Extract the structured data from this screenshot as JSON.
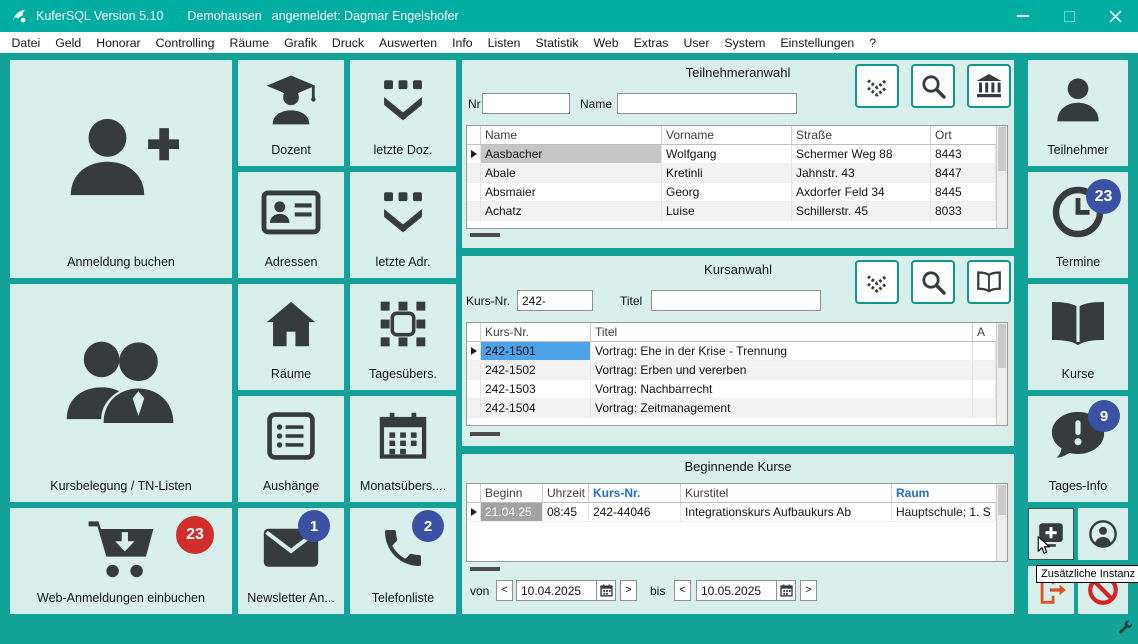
{
  "titlebar": {
    "app": "KuferSQL Version 5.10",
    "location": "Demohausen",
    "login": "angemeldet: Dagmar Engelshofer"
  },
  "menu": [
    "Datei",
    "Geld",
    "Honorar",
    "Controlling",
    "Räume",
    "Grafik",
    "Druck",
    "Auswerten",
    "Info",
    "Listen",
    "Statistik",
    "Web",
    "Extras",
    "User",
    "System",
    "Einstellungen",
    "?"
  ],
  "tiles": {
    "anmeldung_buchen": "Anmeldung buchen",
    "kursbelegung": "Kursbelegung / TN-Listen",
    "web_anmeldungen": "Web-Anmeldungen einbuchen",
    "web_anmeldungen_badge": "23",
    "dozent": "Dozent",
    "adressen": "Adressen",
    "raeume": "Räume",
    "aushaenge": "Aushänge",
    "newsletter": "Newsletter An...",
    "newsletter_badge": "1",
    "letzte_doz": "letzte Doz.",
    "letzte_adr": "letzte Adr.",
    "tagesuebers": "Tagesübers.",
    "monatsuebers": "Monatsübers....",
    "telefonliste": "Telefonliste",
    "telefonliste_badge": "2",
    "teilnehmer": "Teilnehmer",
    "termine": "Termine",
    "termine_badge": "23",
    "kurse": "Kurse",
    "tages_info": "Tages-Info",
    "tages_info_badge": "9"
  },
  "teilnehmeranwahl": {
    "title": "Teilnehmeranwahl",
    "nr_label": "Nr",
    "name_label": "Name",
    "headers": [
      "Name",
      "Vorname",
      "Straße",
      "Ort"
    ],
    "rows": [
      [
        "Aasbacher",
        "Wolfgang",
        "Schermer Weg 88",
        "8443"
      ],
      [
        "Abale",
        "Kretinli",
        "Jahnstr. 43",
        "8447"
      ],
      [
        "Absmaier",
        "Georg",
        "Axdorfer Feld 34",
        "8445"
      ],
      [
        "Achatz",
        "Luise",
        "Schillerstr. 45",
        "8033"
      ]
    ]
  },
  "kursanwahl": {
    "title": "Kursanwahl",
    "kursnr_label": "Kurs-Nr.",
    "kursnr_value": "242-",
    "titel_label": "Titel",
    "headers": [
      "Kurs-Nr.",
      "Titel",
      "A"
    ],
    "rows": [
      [
        "242-1501",
        "Vortrag: Ehe in der Krise - Trennung"
      ],
      [
        "242-1502",
        "Vortrag: Erben und vererben"
      ],
      [
        "242-1503",
        "Vortrag: Nachbarrecht"
      ],
      [
        "242-1504",
        "Vortrag: Zeitmanagement"
      ]
    ]
  },
  "beginnende_kurse": {
    "title": "Beginnende Kurse",
    "headers": [
      "Beginn",
      "Uhrzeit",
      "Kurs-Nr.",
      "Kurstitel",
      "Raum"
    ],
    "rows": [
      [
        "21.04.25",
        "08:45",
        "242-44046",
        "Integrationskurs Aufbaukurs Ab",
        "Hauptschule; 1. S"
      ]
    ],
    "von_label": "von",
    "bis_label": "bis",
    "von_value": "10.04.2025",
    "bis_value": "10.05.2025",
    "prev": "<",
    "next": ">"
  },
  "tooltip": "Zusätzliche Instanz",
  "icons": {
    "person_plus": "person-with-plus",
    "people": "two-persons",
    "cart_download": "shopping-cart-with-down-arrow",
    "graduate": "person-with-mortarboard",
    "contact_card": "address-card",
    "house": "home",
    "notice_list": "bulleted-card",
    "envelope": "mail",
    "dots_chevron": "dots-with-down-chevron",
    "frame_handles": "selection-frame",
    "calendar_grid": "month-calendar",
    "phone": "handset",
    "person": "person-silhouette",
    "clock": "clock-face",
    "open_book": "open-book",
    "speech_exclaim": "speech-bubble-exclamation",
    "double_chevron_down": "dotted-double-chevron",
    "magnifier": "search",
    "bank": "institution-columns",
    "book_outline": "open-book-outline",
    "screen_plus": "add-instance",
    "person_circle": "user-circle",
    "logout": "red-exit-door",
    "prohibition": "red-slashed-circle",
    "wrench": "wrench",
    "calendar_small": "date-picker"
  },
  "colors": {
    "titlebar": "#00ada1",
    "background": "#12a298",
    "tile": "#d9efeb",
    "badge_red": "#d22d2a",
    "badge_blue": "#3b51a3",
    "selected_blue": "#4da3e8",
    "header_blue": "#1f6fd0"
  }
}
